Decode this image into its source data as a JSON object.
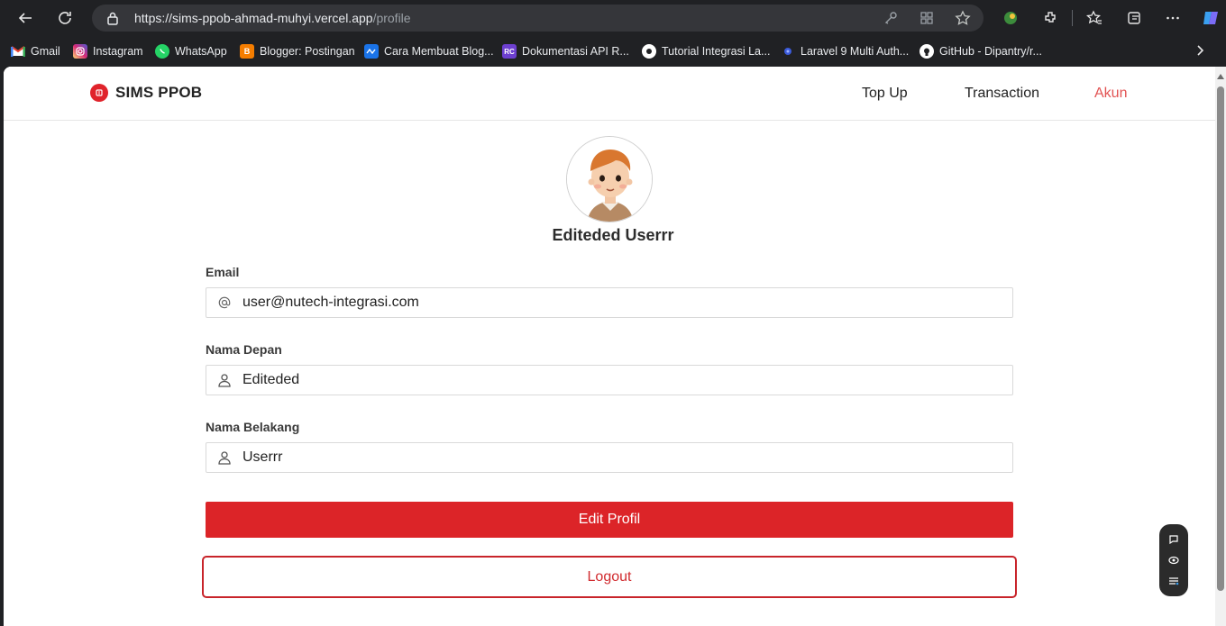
{
  "browser": {
    "url_host": "https://sims-ppob-ahmad-muhyi.vercel.app",
    "url_path": "/profile"
  },
  "bookmarks": [
    {
      "label": "Gmail",
      "icon": "gmail-icon",
      "color": "#ea4335",
      "glyph": "M"
    },
    {
      "label": "Instagram",
      "icon": "instagram-icon",
      "color": "#d62976",
      "glyph": "◎"
    },
    {
      "label": "WhatsApp",
      "icon": "whatsapp-icon",
      "color": "#25d366",
      "glyph": "✆"
    },
    {
      "label": "Blogger: Postingan",
      "icon": "blogger-icon",
      "color": "#f57d00",
      "glyph": "B"
    },
    {
      "label": "Cara Membuat Blog...",
      "icon": "blog-icon",
      "color": "#1a73e8",
      "glyph": "≈"
    },
    {
      "label": "Dokumentasi API R...",
      "icon": "rc-icon",
      "color": "#7c3aed",
      "glyph": "RC"
    },
    {
      "label": "Tutorial Integrasi La...",
      "icon": "tutorial-icon",
      "color": "#ffffff",
      "glyph": "●"
    },
    {
      "label": "Laravel 9 Multi Auth...",
      "icon": "laravel-icon",
      "color": "#3b5bdb",
      "glyph": "•"
    },
    {
      "label": "GitHub - Dipantry/r...",
      "icon": "github-icon",
      "color": "#ffffff",
      "glyph": "●"
    }
  ],
  "app": {
    "brand": "SIMS PPOB",
    "nav": {
      "topup": "Top Up",
      "transaction": "Transaction",
      "account": "Akun"
    },
    "accent_color": "#dc2428"
  },
  "profile": {
    "name": "Editeded Userrr",
    "email_label": "Email",
    "email_value": "user@nutech-integrasi.com",
    "first_name_label": "Nama Depan",
    "first_name_value": "Editeded",
    "last_name_label": "Nama Belakang",
    "last_name_value": "Userrr",
    "edit_button": "Edit Profil",
    "logout_button": "Logout"
  }
}
